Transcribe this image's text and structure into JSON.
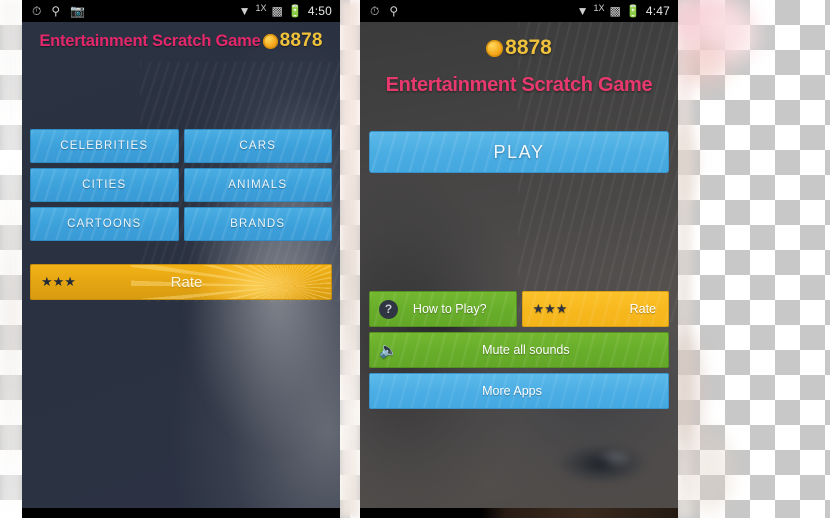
{
  "backdrop": {
    "kind": "transparency-checkerboard"
  },
  "phones": {
    "left": {
      "status_bar": {
        "icons_left": [
          "alarm-clock-icon",
          "pin-icon",
          "camera-icon"
        ],
        "icons_right": [
          "wifi-icon",
          "signal-icon",
          "battery-icon"
        ],
        "network_label": "1X",
        "time": "4:50"
      },
      "header": {
        "title": "Entertainment Scratch Game",
        "coin_icon": "coin-icon",
        "coin_count": "8878"
      },
      "categories": [
        {
          "label": "CELEBRITIES"
        },
        {
          "label": "CARS"
        },
        {
          "label": "CITIES"
        },
        {
          "label": "ANIMALS"
        },
        {
          "label": "CARTOONS"
        },
        {
          "label": "BRANDS"
        }
      ],
      "rate_bar": {
        "stars": "★★★",
        "label": "Rate"
      }
    },
    "right": {
      "status_bar": {
        "icons_left": [
          "alarm-clock-icon",
          "pin-icon"
        ],
        "icons_right": [
          "wifi-icon",
          "signal-icon",
          "battery-icon"
        ],
        "network_label": "1X",
        "time": "4:47"
      },
      "header": {
        "coin_icon": "coin-icon",
        "coin_count": "8878",
        "title": "Entertainment Scratch Game"
      },
      "play_button": {
        "label": "PLAY"
      },
      "menu": {
        "how_to_play": {
          "label": "How to Play?",
          "icon": "question-mark-icon"
        },
        "rate": {
          "label": "Rate",
          "stars": "★★★"
        },
        "mute": {
          "label": "Mute all sounds",
          "icon": "speaker-icon"
        },
        "more_apps": {
          "label": "More Apps"
        }
      }
    }
  },
  "colors": {
    "title_pink": "#e2286b",
    "coin_gold": "#f0c23c",
    "button_blue": "#3ca0da",
    "button_green": "#68ad2a",
    "button_yellow": "#f7b81e",
    "screen_navy": "#2b3242",
    "status_bar_black": "#000000"
  }
}
